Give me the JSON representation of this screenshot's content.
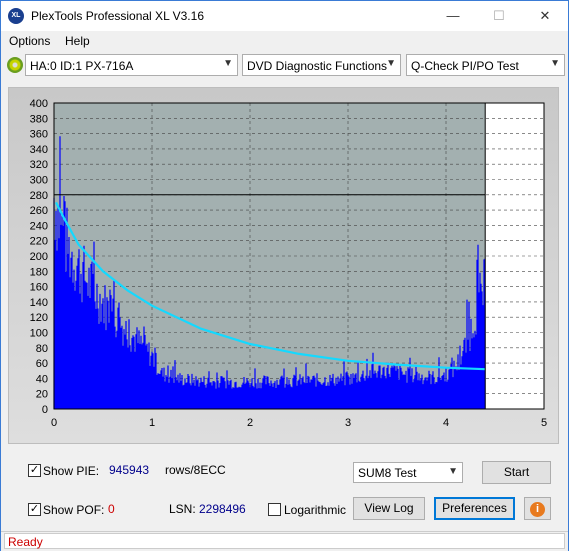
{
  "window": {
    "title": "PlexTools Professional XL V3.16",
    "icon": "plextools-xl-icon"
  },
  "titlebar": {
    "minimize": "—",
    "maximize": "☐",
    "close": "✕"
  },
  "menu": [
    "Options",
    "Help"
  ],
  "toolbar": {
    "drive": "HA:0 ID:1  PX-716A",
    "function": "DVD Diagnostic Functions",
    "test": "Q-Check PI/PO Test"
  },
  "chart_data": {
    "type": "bar",
    "colors": {
      "pie_bars": "#0000ff",
      "trend": "#14d9ff",
      "plot_bg": "#a3b0b0",
      "plot_bg_empty": "#ffffff"
    },
    "xlim": [
      0,
      5
    ],
    "ylim": [
      0,
      400
    ],
    "x_ticks": [
      "0",
      "1",
      "2",
      "3",
      "4",
      "5"
    ],
    "y_ticks": [
      "0",
      "20",
      "40",
      "60",
      "80",
      "100",
      "120",
      "140",
      "160",
      "180",
      "200",
      "220",
      "240",
      "260",
      "280",
      "300",
      "320",
      "340",
      "360",
      "380",
      "400"
    ],
    "data_end_x": 4.4,
    "cursor": {
      "x": 4.4,
      "y": 280
    },
    "grid": true,
    "pie_envelope": [
      {
        "x": 0.0,
        "y": 300
      },
      {
        "x": 0.05,
        "y": 270
      },
      {
        "x": 0.15,
        "y": 225
      },
      {
        "x": 0.3,
        "y": 190
      },
      {
        "x": 0.5,
        "y": 150
      },
      {
        "x": 0.75,
        "y": 110
      },
      {
        "x": 1.0,
        "y": 75
      },
      {
        "x": 1.1,
        "y": 50
      },
      {
        "x": 1.3,
        "y": 42
      },
      {
        "x": 1.6,
        "y": 38
      },
      {
        "x": 2.0,
        "y": 38
      },
      {
        "x": 2.5,
        "y": 40
      },
      {
        "x": 3.0,
        "y": 42
      },
      {
        "x": 3.2,
        "y": 50
      },
      {
        "x": 3.4,
        "y": 56
      },
      {
        "x": 3.6,
        "y": 48
      },
      {
        "x": 3.9,
        "y": 44
      },
      {
        "x": 4.05,
        "y": 52
      },
      {
        "x": 4.15,
        "y": 70
      },
      {
        "x": 4.25,
        "y": 110
      },
      {
        "x": 4.33,
        "y": 150
      },
      {
        "x": 4.4,
        "y": 175
      }
    ],
    "trend_line": [
      {
        "x": 0.02,
        "y": 270
      },
      {
        "x": 0.1,
        "y": 250
      },
      {
        "x": 0.25,
        "y": 215
      },
      {
        "x": 0.5,
        "y": 180
      },
      {
        "x": 0.75,
        "y": 155
      },
      {
        "x": 1.0,
        "y": 135
      },
      {
        "x": 1.5,
        "y": 105
      },
      {
        "x": 2.0,
        "y": 85
      },
      {
        "x": 2.5,
        "y": 72
      },
      {
        "x": 3.0,
        "y": 63
      },
      {
        "x": 3.5,
        "y": 58
      },
      {
        "x": 4.0,
        "y": 54
      },
      {
        "x": 4.4,
        "y": 52
      }
    ]
  },
  "controls": {
    "show_pie_label": "Show PIE:",
    "pie_value": "945943",
    "rows_label": "rows/8ECC",
    "show_pof_label": "Show POF:",
    "pof_value": "0",
    "lsn_label": "LSN:",
    "lsn_value": "2298496",
    "log_label": "Logarithmic",
    "sum_select": "SUM8 Test",
    "start_button": "Start",
    "viewlog_button": "View Log",
    "prefs_button": "Preferences",
    "info_button": "i",
    "pie_color": "#00008b",
    "pof_color": "#cc0000"
  },
  "status": {
    "text": "Ready",
    "color": "#cc0000"
  }
}
